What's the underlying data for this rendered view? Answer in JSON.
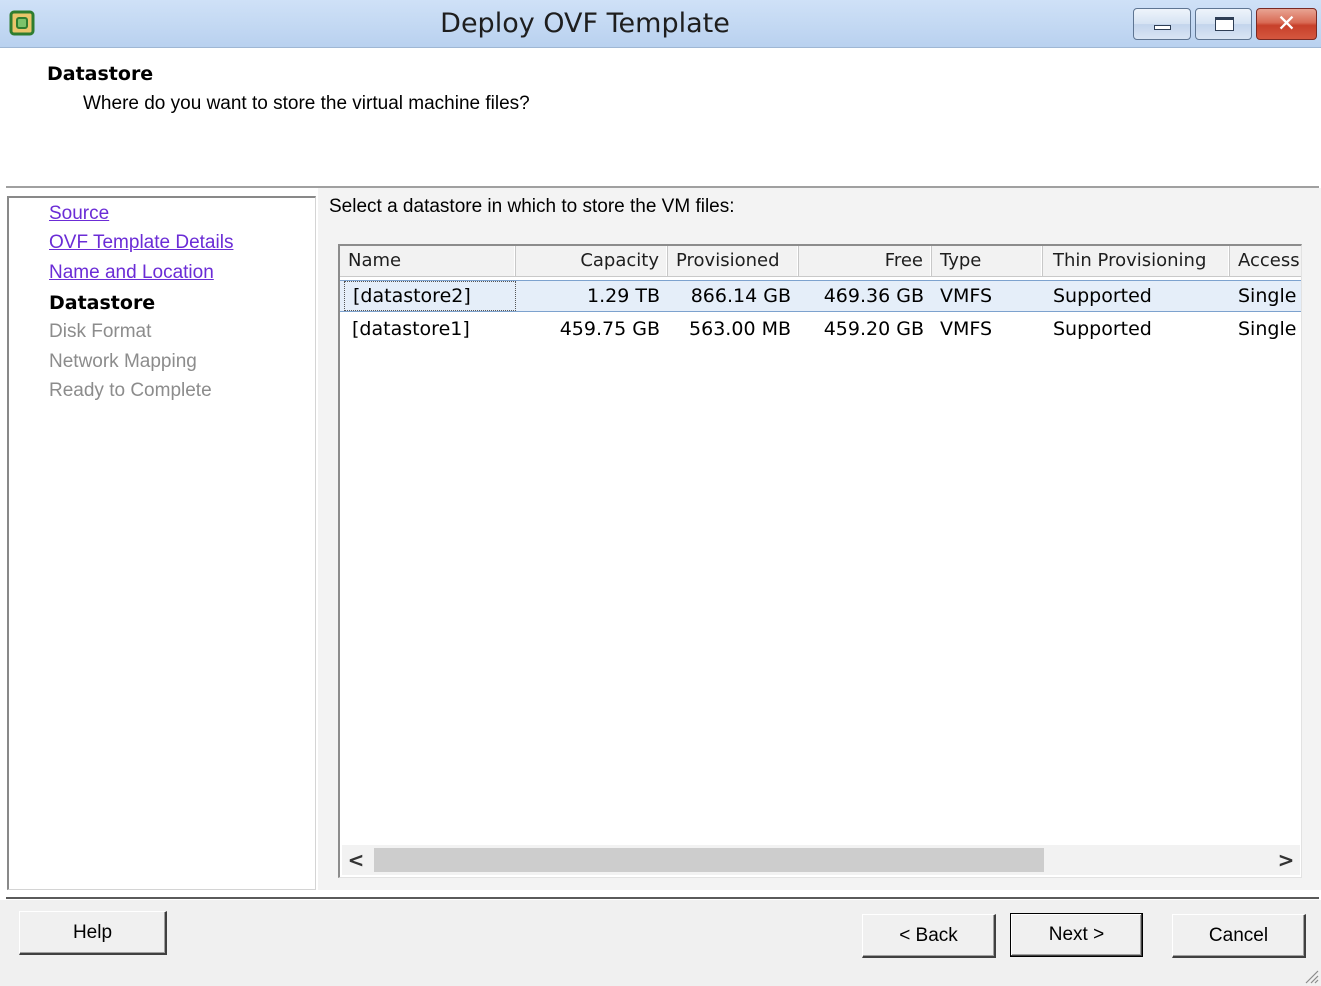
{
  "window": {
    "title": "Deploy OVF Template",
    "close_glyph": "✕"
  },
  "header": {
    "title": "Datastore",
    "subtitle": "Where do you want to store the virtual machine files?"
  },
  "nav": {
    "items": [
      {
        "label": "Source",
        "state": "link"
      },
      {
        "label": "OVF Template Details",
        "state": "link"
      },
      {
        "label": "Name and Location",
        "state": "link"
      },
      {
        "label": "Datastore",
        "state": "current"
      },
      {
        "label": "Disk Format",
        "state": "disabled"
      },
      {
        "label": "Network Mapping",
        "state": "disabled"
      },
      {
        "label": "Ready to Complete",
        "state": "disabled"
      }
    ]
  },
  "main": {
    "instruction": "Select a datastore in which to store the VM files:",
    "table": {
      "columns": [
        "Name",
        "Capacity",
        "Provisioned",
        "Free",
        "Type",
        "Thin Provisioning",
        "Access"
      ],
      "rows": [
        [
          "[datastore2]",
          "1.29 TB",
          "866.14 GB",
          "469.36 GB",
          "VMFS",
          "Supported",
          "Single"
        ],
        [
          "[datastore1]",
          "459.75 GB",
          "563.00 MB",
          "459.20 GB",
          "VMFS",
          "Supported",
          "Single"
        ]
      ],
      "selected_row": 0
    },
    "scroll": {
      "left_arrow": "<",
      "right_arrow": ">"
    }
  },
  "footer": {
    "help_label": "Help",
    "back_label": "< Back",
    "next_label": "Next >",
    "cancel_label": "Cancel"
  },
  "colors": {
    "link": "#6b2cd6",
    "disabled": "#8c8c8c",
    "selection": "#e5eef9",
    "titlebar": "#c4d9f3"
  }
}
